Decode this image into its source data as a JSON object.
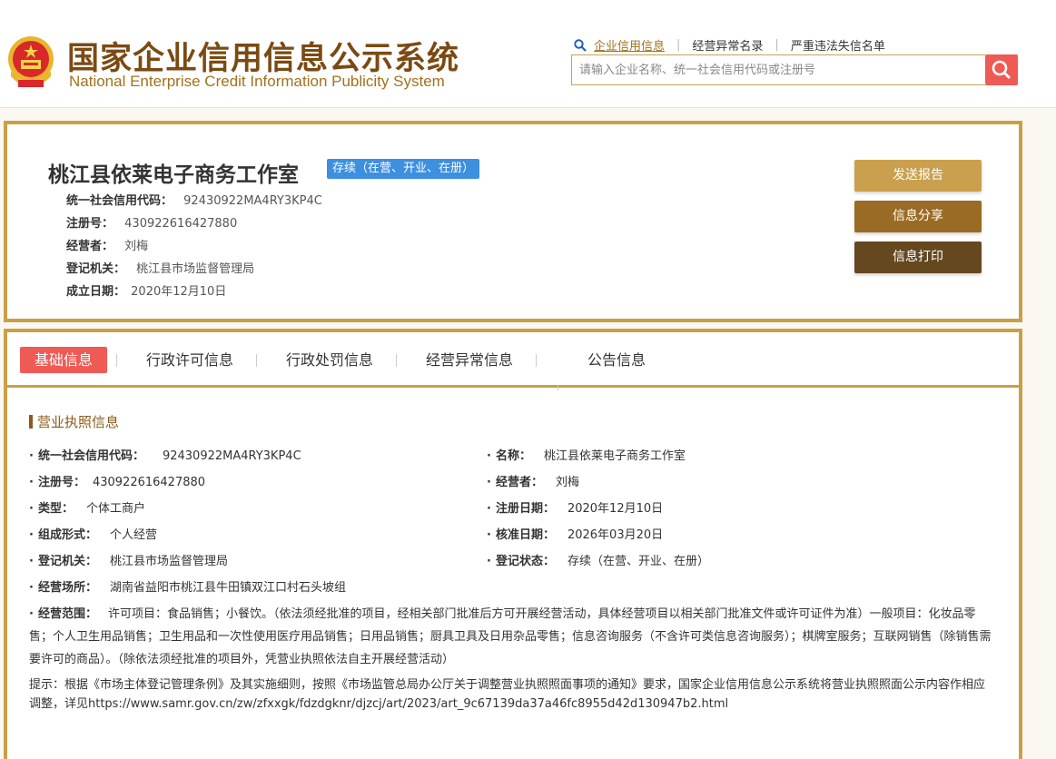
{
  "header": {
    "title_cn": "国家企业信用信息公示系统",
    "title_en": "National Enterprise Credit Information Publicity System",
    "nav": {
      "credit_info": "企业信用信息",
      "abnormal_list": "经营异常名录",
      "blacklist": "严重违法失信名单"
    },
    "search": {
      "placeholder": "请输入企业名称、统一社会信用代码或注册号",
      "value": ""
    }
  },
  "company": {
    "name": "桃江县依莱电子商务工作室",
    "status": "存续（在营、开业、在册）",
    "rows": [
      {
        "label": "统一社会信用代码：",
        "value": "92430922MA4RY3KP4C"
      },
      {
        "label": "注册号：",
        "value": "430922616427880"
      },
      {
        "label": "经营者：",
        "value": "刘梅"
      },
      {
        "label": "登记机关：",
        "value": "桃江县市场监督管理局"
      },
      {
        "label": "成立日期：",
        "value": "2020年12月10日"
      }
    ],
    "buttons": {
      "report": "发送报告",
      "share": "信息分享",
      "print": "信息打印"
    }
  },
  "tabs": [
    "基础信息",
    "行政许可信息",
    "行政处罚信息",
    "经营异常信息",
    "公告信息"
  ],
  "license": {
    "section_title": "营业执照信息",
    "left": [
      {
        "label": "统一社会信用代码：",
        "value": "92430922MA4RY3KP4C"
      },
      {
        "label": "注册号：",
        "value": "430922616427880"
      },
      {
        "label": "类型：",
        "value": "个体工商户"
      },
      {
        "label": "组成形式：",
        "value": "个人经营"
      },
      {
        "label": "登记机关：",
        "value": "桃江县市场监督管理局"
      },
      {
        "label": "经营场所：",
        "value": "湖南省益阳市桃江县牛田镇双江口村石头坡组"
      }
    ],
    "right": [
      {
        "label": "名称：",
        "value": "桃江县依莱电子商务工作室"
      },
      {
        "label": "经营者：",
        "value": "刘梅"
      },
      {
        "label": "注册日期：",
        "value": "2020年12月10日"
      },
      {
        "label": "核准日期：",
        "value": "2026年03月20日"
      },
      {
        "label": "登记状态：",
        "value": "存续（在营、开业、在册）"
      }
    ],
    "scope_label": "经营范围：",
    "scope_value": "许可项目：食品销售；小餐饮。（依法须经批准的项目，经相关部门批准后方可开展经营活动，具体经营项目以相关部门批准文件或许可证件为准）一般项目：化妆品零售；个人卫生用品销售；卫生用品和一次性使用医疗用品销售；日用品销售；厨具卫具及日用杂品零售；信息咨询服务（不含许可类信息咨询服务）；棋牌室服务；互联网销售（除销售需要许可的商品）。（除依法须经批准的项目外，凭营业执照依法自主开展经营活动）",
    "notice": "提示：根据《市场主体登记管理条例》及其实施细则，按照《市场监管总局办公厅关于调整营业执照照面事项的通知》要求，国家企业信用信息公示系统将营业执照照面公示内容作相应调整，详见https://www.samr.gov.cn/zw/zfxxgk/fdzdgknr/djzcj/art/2023/art_9c67139da37a46fc8955d42d130947b2.html"
  },
  "colors": {
    "gold": "#c9a046",
    "brown": "#7b4a12",
    "red": "#ef5a55",
    "blue_badge": "#3d8fe0"
  }
}
